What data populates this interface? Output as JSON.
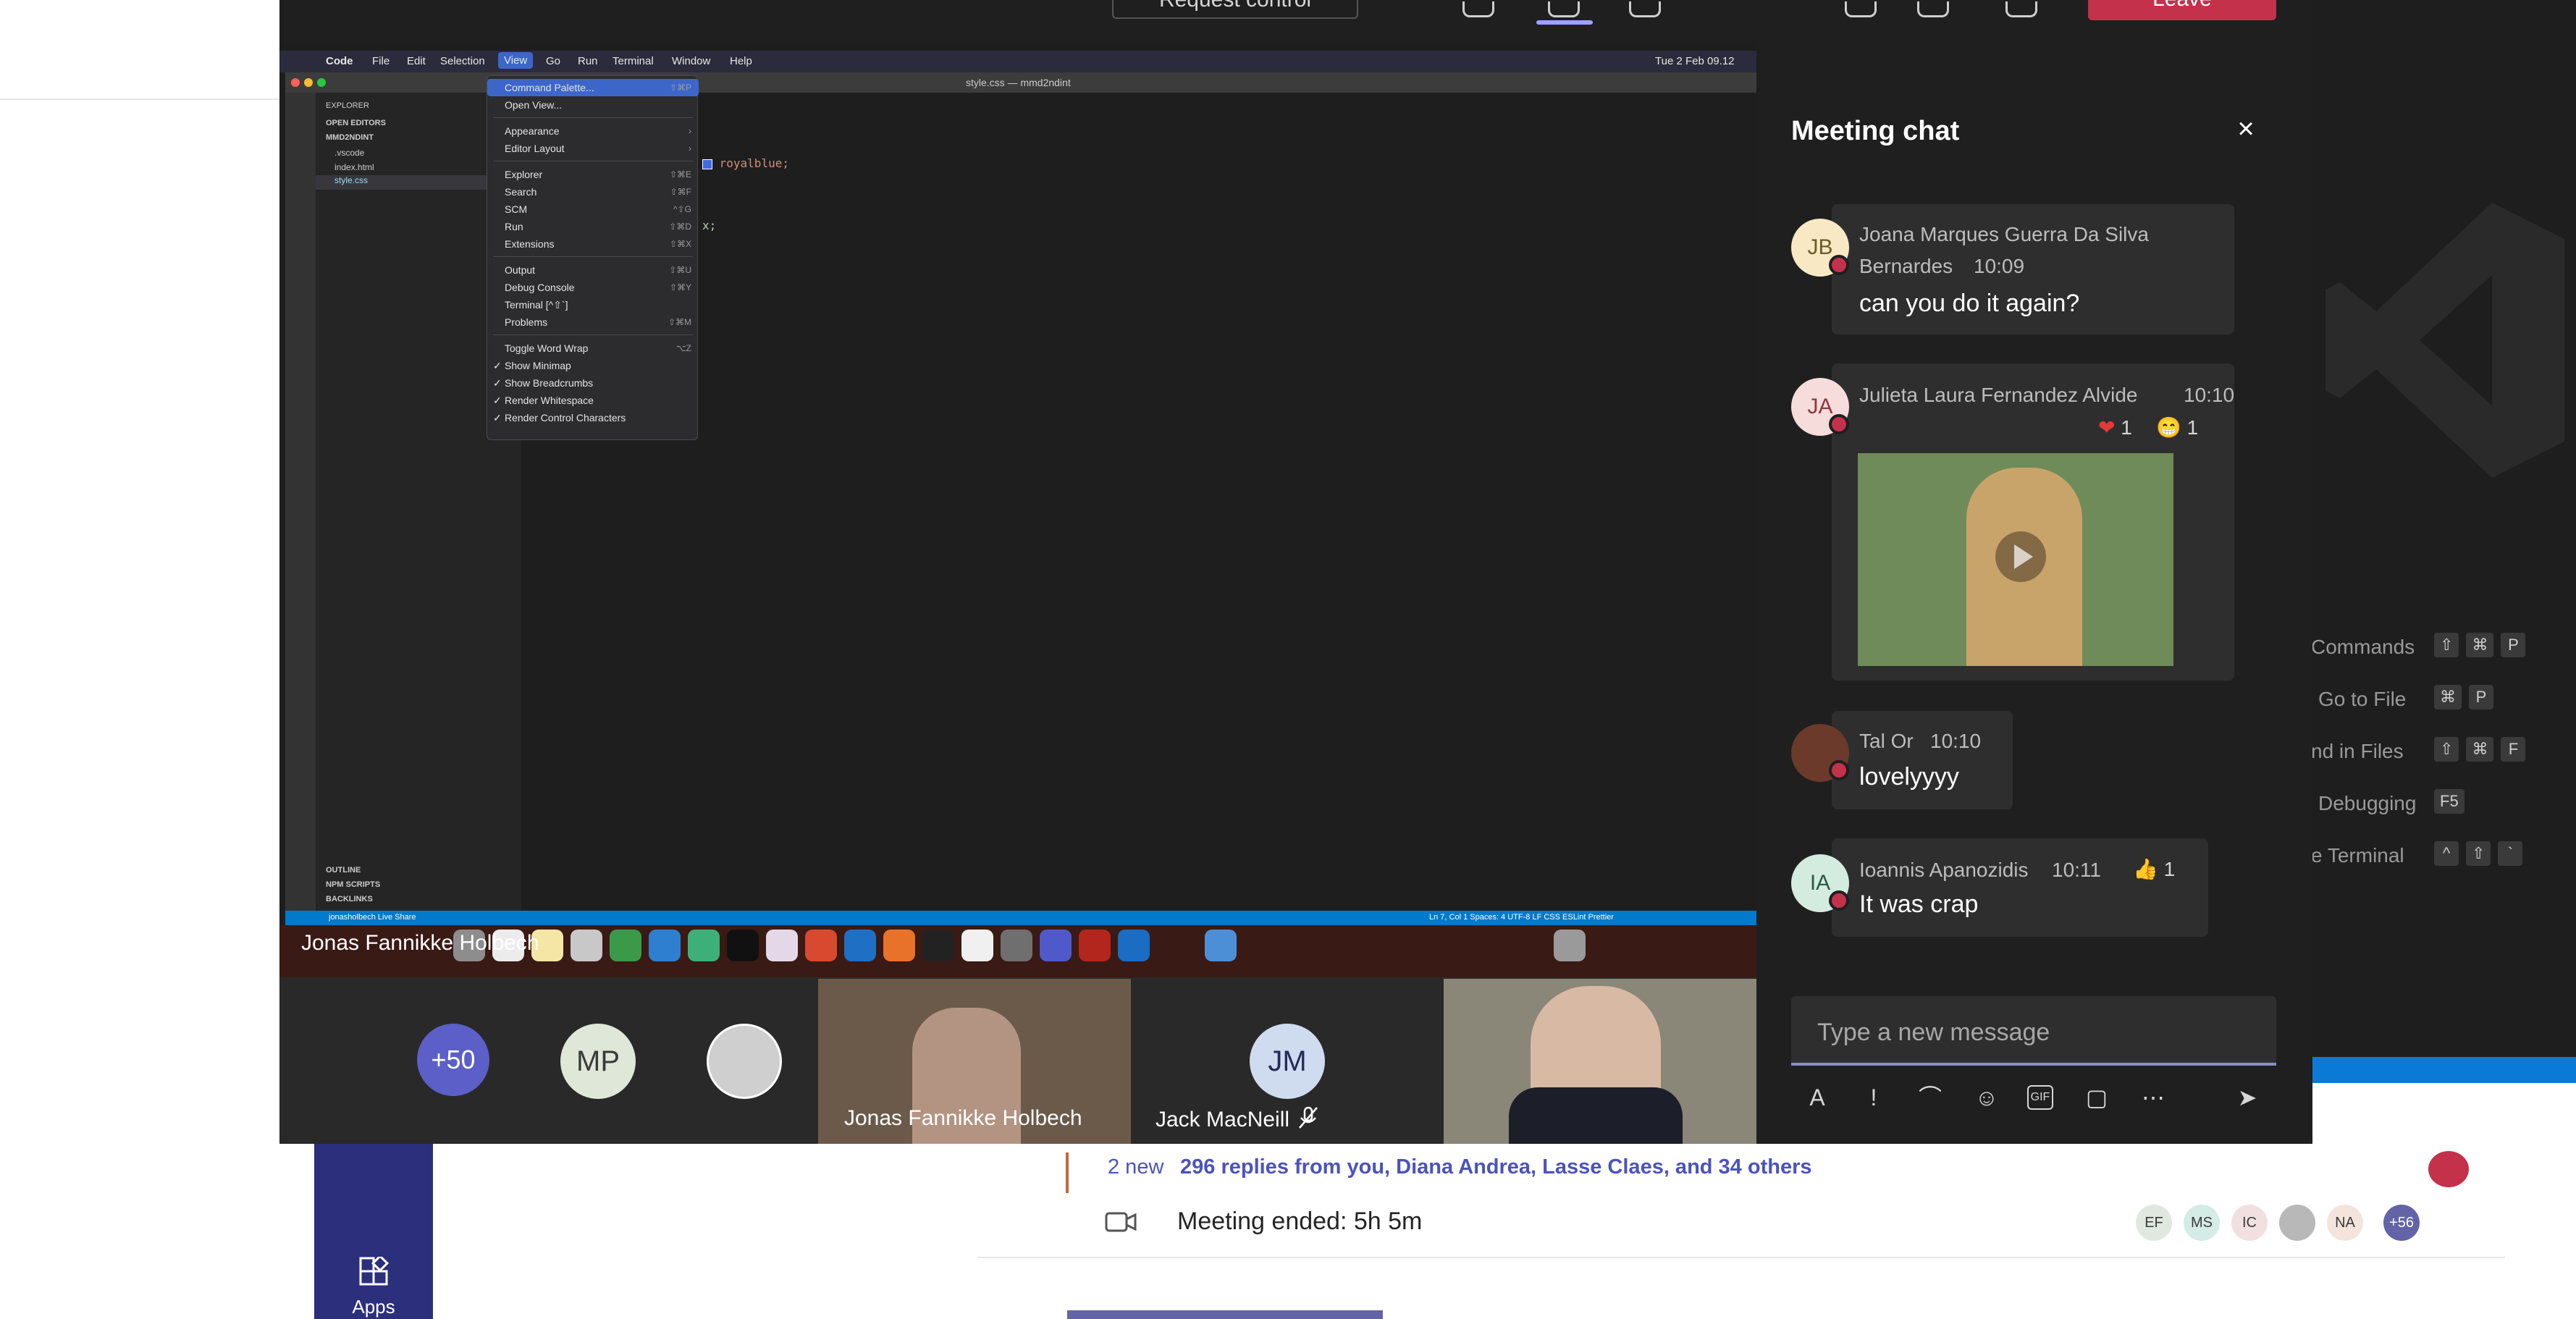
{
  "teams": {
    "apps_label": "Apps",
    "replies": {
      "new_badge": "2 new",
      "text": "296 replies from you, Diana Andrea, Lasse Claes, and 34 others"
    },
    "meeting_ended": "Meeting ended: 5h 5m",
    "mini_avatars": [
      "EF",
      "MS",
      "IC",
      "",
      "NA",
      "+56"
    ]
  },
  "vscode_welcome": {
    "shortcuts": [
      {
        "label": "Commands",
        "keys": [
          "⇧",
          "⌘",
          "P"
        ]
      },
      {
        "label": "Go to File",
        "keys": [
          "⌘",
          "P"
        ]
      },
      {
        "label": "nd in Files",
        "keys": [
          "⇧",
          "⌘",
          "F"
        ]
      },
      {
        "label": "Debugging",
        "keys": [
          "F5"
        ]
      },
      {
        "label": "e Terminal",
        "keys": [
          "^",
          "⇧",
          "`"
        ]
      }
    ]
  },
  "meeting": {
    "request_control": "Request control",
    "leave": "Leave",
    "presenter": "Jonas Fannikke Holbech"
  },
  "shared_screen": {
    "mac_menubar": [
      "Code",
      "File",
      "Edit",
      "Selection",
      "View",
      "Go",
      "Run",
      "Terminal",
      "Window",
      "Help"
    ],
    "clock": "Tue 2 Feb  09.12",
    "window_title": "style.css — mmd2ndint",
    "explorer": {
      "title": "EXPLORER",
      "open_editors": "OPEN EDITORS",
      "project": "MMD2NDINT",
      "files": [
        ".vscode",
        "index.html",
        "style.css"
      ],
      "outline": "OUTLINE",
      "npm_scripts": "NPM SCRIPTS",
      "backlinks": "BACKLINKS"
    },
    "code_lines": [
      "royalblue;",
      "x;"
    ],
    "status_left": "jonasholbech   Live Share",
    "status_right": "Ln 7, Col 1   Spaces: 4   UTF-8   LF   CSS   ESLint   Prettier",
    "view_menu": [
      {
        "label": "Command Palette...",
        "shortcut": "⇧⌘P",
        "highlight": true
      },
      {
        "label": "Open View...",
        "shortcut": ""
      },
      {
        "sep": true
      },
      {
        "label": "Appearance",
        "submenu": true
      },
      {
        "label": "Editor Layout",
        "submenu": true
      },
      {
        "sep": true
      },
      {
        "label": "Explorer",
        "shortcut": "⇧⌘E"
      },
      {
        "label": "Search",
        "shortcut": "⇧⌘F"
      },
      {
        "label": "SCM",
        "shortcut": "^⇧G"
      },
      {
        "label": "Run",
        "shortcut": "⇧⌘D"
      },
      {
        "label": "Extensions",
        "shortcut": "⇧⌘X"
      },
      {
        "sep": true
      },
      {
        "label": "Output",
        "shortcut": "⇧⌘U"
      },
      {
        "label": "Debug Console",
        "shortcut": "⇧⌘Y"
      },
      {
        "label": "Terminal [^⇧`]",
        "shortcut": ""
      },
      {
        "label": "Problems",
        "shortcut": "⇧⌘M"
      },
      {
        "sep": true
      },
      {
        "label": "Toggle Word Wrap",
        "shortcut": "⌥Z"
      },
      {
        "label": "Show Minimap",
        "checked": true
      },
      {
        "label": "Show Breadcrumbs",
        "checked": true
      },
      {
        "label": "Render Whitespace",
        "checked": true
      },
      {
        "label": "Render Control Characters",
        "checked": true
      }
    ]
  },
  "participants": {
    "overflow": "+50",
    "mp": "MP",
    "jm": "JM",
    "jonas_name": "Jonas Fannikke Holbech",
    "jack_name": "Jack MacNeill"
  },
  "chat": {
    "title": "Meeting chat",
    "messages": [
      {
        "initials": "JB",
        "author_line1": "Joana Marques Guerra Da Silva",
        "author_line2": "Bernardes",
        "time": "10:09",
        "text": "can you do it again?"
      },
      {
        "initials": "JA",
        "author": "Julieta Laura Fernandez Alvide",
        "time": "10:10",
        "reactions": [
          {
            "emoji": "❤",
            "count": "1"
          },
          {
            "emoji": "😁",
            "count": "1"
          }
        ]
      },
      {
        "initials": "",
        "author": "Tal Or",
        "time": "10:10",
        "text": "lovelyyyy"
      },
      {
        "initials": "IA",
        "author": "Ioannis Apanozidis",
        "time": "10:11",
        "text": "It was crap",
        "reactions": [
          {
            "emoji": "👍",
            "count": "1"
          }
        ]
      }
    ],
    "compose_placeholder": "Type a new message"
  },
  "colors": {
    "teams_purple": "#6264a7",
    "leave_red": "#c4314b",
    "vscode_blue": "#007acc"
  }
}
